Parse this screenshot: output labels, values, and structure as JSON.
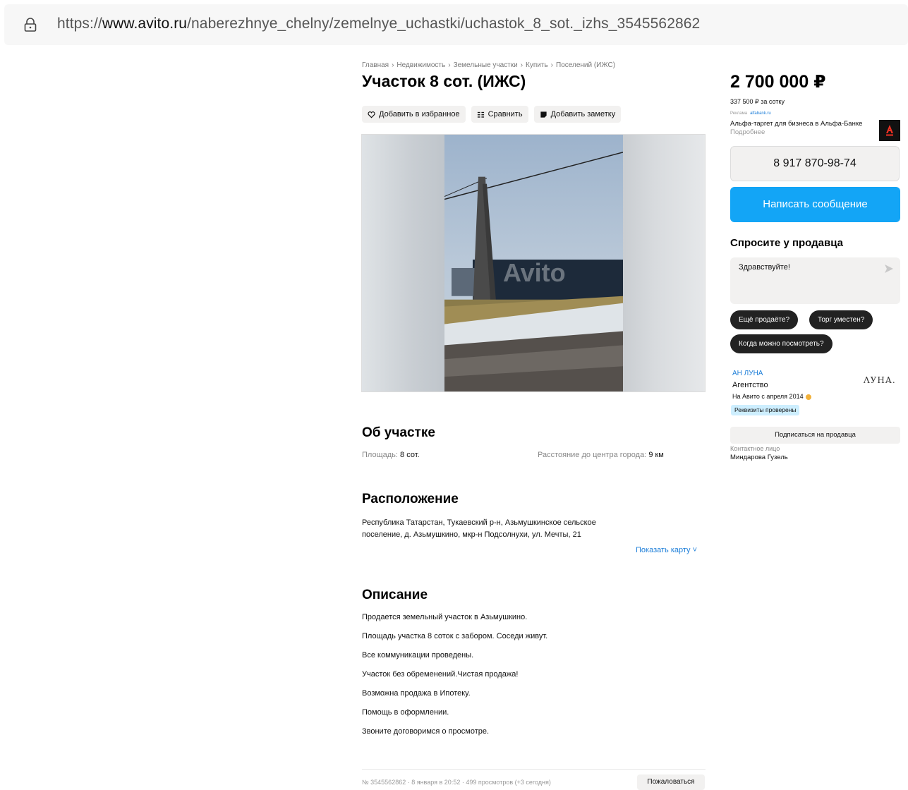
{
  "browser": {
    "url_prefix": "https://",
    "url_domain": "www.avito.ru",
    "url_path": "/naberezhnye_chelny/zemelnye_uchastki/uchastok_8_sot._izhs_3545562862"
  },
  "breadcrumb": [
    "Главная",
    "Недвижимость",
    "Земельные участки",
    "Купить",
    "Поселений (ИЖС)"
  ],
  "breadcrumb_sep": "›",
  "title": "Участок 8 сот. (ИЖС)",
  "actions": {
    "favorite": "Добавить в избранное",
    "compare": "Сравнить",
    "note": "Добавить заметку"
  },
  "photo": {
    "watermark": "Avito"
  },
  "about": {
    "heading": "Об участке",
    "area_label": "Площадь:",
    "area_value": "8 сот.",
    "distance_label": "Расстояние до центра города:",
    "distance_value": "9 км"
  },
  "location": {
    "heading": "Расположение",
    "address": "Республика Татарстан, Тукаевский р-н, Азьмушкинское сельское поселение, д. Азьмушкино, мкр-н Подсолнухи, ул. Мечты, 21",
    "show_map": "Показать карту ˅"
  },
  "description": {
    "heading": "Описание",
    "lines": [
      "Продается земельный участок в Азьмушкино.",
      "Площадь участка 8 соток с забором. Соседи живут.",
      "Все коммуникации проведены.",
      "Участок без обременений.Чистая продажа!",
      "Возможна продажа в Ипотеку.",
      "Помощь в оформлении.",
      "Звоните договоримся о просмотре."
    ]
  },
  "footer": {
    "meta": "№ 3545562862 · 8 января в 20:52 · 499 просмотров (+3 сегодня)",
    "report": "Пожаловаться"
  },
  "sidebar": {
    "price": "2 700 000 ₽",
    "price_per": "337 500 ₽ за сотку",
    "ad_label": "Реклама",
    "ad_link": "alfabank.ru",
    "ad_text": "Альфа-таргет для бизнеса в Альфа-Банке",
    "ad_more": "Подробнее",
    "ad_logo": "А",
    "phone": "8 917 870-98-74",
    "message_button": "Написать сообщение",
    "ask_heading": "Спросите у продавца",
    "ask_value": "Здравствуйте!",
    "chips": [
      "Ещё продаёте?",
      "Торг уместен?",
      "Когда можно посмотреть?"
    ],
    "seller_name": "АН ЛУНА",
    "seller_type": "Агентство",
    "seller_since": "На Авито с апреля 2014",
    "verified": "Реквизиты проверены",
    "seller_logo": "ΛУНА.",
    "subscribe": "Подписаться на продавца",
    "contact_label": "Контактное лицо",
    "contact_name": "Миндарова Гузель"
  },
  "colors": {
    "accent_blue": "#13a5f6",
    "link_blue": "#1e7fd9",
    "button_gray": "#f2f1f0",
    "chip_dark": "#222222",
    "alfa_red": "#ef3124"
  },
  "icons": [
    "lock-icon",
    "heart-icon",
    "compare-icon",
    "note-icon",
    "send-icon",
    "medal-icon"
  ]
}
